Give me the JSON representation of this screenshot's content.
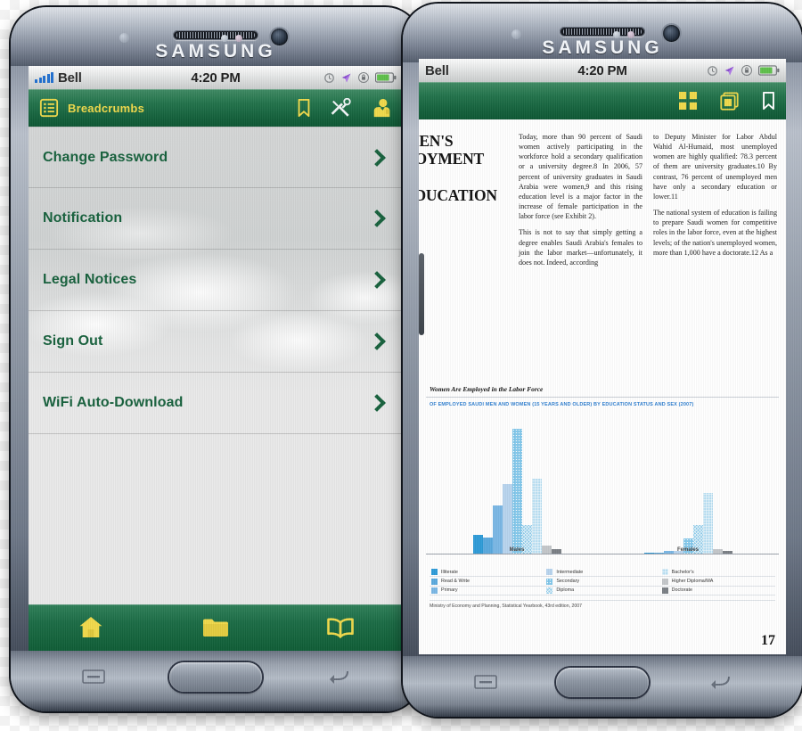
{
  "device": {
    "brand": "SAMSUNG"
  },
  "status_bar": {
    "carrier": "Bell",
    "time": "4:20 PM",
    "icons": [
      "clock-icon",
      "location-arrow-icon",
      "rotation-lock-icon",
      "battery-icon"
    ],
    "signal_bars": 5
  },
  "left_phone": {
    "nav": {
      "title": "Breadcrumbs",
      "menu_icon": "list-icon",
      "actions": [
        "bookmark-icon",
        "tools-icon",
        "contact-icon"
      ]
    },
    "menu_items": [
      {
        "label": "Change Password"
      },
      {
        "label": "Notification"
      },
      {
        "label": "Legal Notices"
      },
      {
        "label": "Sign Out"
      },
      {
        "label": "WiFi Auto-Download"
      }
    ],
    "tabbar": [
      {
        "icon": "home-icon",
        "label": "Home"
      },
      {
        "icon": "folder-icon",
        "label": "Library"
      },
      {
        "icon": "book-icon",
        "label": "Reader"
      }
    ]
  },
  "right_phone": {
    "nav": {
      "actions": [
        "grid-icon",
        "layers-icon",
        "bookmark-icon"
      ]
    },
    "document": {
      "heading": "WOMEN'S EMPLOYMENT AND EDUCATION",
      "heading_visible": [
        "MEN'S",
        "LOYMENT",
        "D EDUCATION"
      ],
      "page_number": "17",
      "column_one": [
        "Today, more than 90 percent of Saudi women actively participating in the workforce hold a secondary qualification or a university degree.8 In 2006, 57 percent of university graduates in Saudi Arabia were women,9 and this rising education level is a major factor in the increase of female participation in the labor force (see Exhibit 2).",
        "This is not to say that simply getting a degree enables Saudi Arabia's females to join the labor market—unfortunately, it does not. Indeed, according"
      ],
      "column_two": [
        "to Deputy Minister for Labor Abdul Wahid Al-Humaid, most unemployed women are highly qualified: 78.3 percent of them are university graduates.10 By contrast, 76 percent of unemployed men have only a secondary education or lower.11",
        "The national system of education is failing to prepare Saudi women for competitive roles in the labor force, even at the highest levels; of the nation's unemployed women, more than 1,000 have a doctorate.12 As a"
      ],
      "exhibit_title": "Women Are Employed in the Labor Force",
      "exhibit_subtitle": "OF EMPLOYED SAUDI MEN AND WOMEN (15 YEARS AND OLDER) BY EDUCATION STATUS AND SEX (2007)",
      "source": "Ministry of Economy and Planning, Statistical Yearbook, 43rd edition, 2007"
    }
  },
  "chart_data": {
    "type": "bar",
    "title": "Women Are Employed in the Labor Force",
    "subtitle": "OF EMPLOYED SAUDI MEN AND WOMEN (15 YEARS AND OLDER) BY EDUCATION STATUS AND SEX (2007)",
    "xlabel": "",
    "ylabel": "",
    "grid": false,
    "legend_position": "bottom",
    "categories": [
      "Males",
      "Females"
    ],
    "series": [
      {
        "name": "Illiterate",
        "color": "#2e9bd8",
        "pattern": "solid",
        "values": [
          14,
          1
        ]
      },
      {
        "name": "Read & Write",
        "color": "#5aa9de",
        "pattern": "solid",
        "values": [
          12,
          1
        ]
      },
      {
        "name": "Primary",
        "color": "#7ab7e5",
        "pattern": "solid",
        "values": [
          36,
          2
        ]
      },
      {
        "name": "Intermediate",
        "color": "#b8d4ee",
        "pattern": "solid",
        "values": [
          52,
          2
        ]
      },
      {
        "name": "Secondary",
        "color": "#7fc6ea",
        "pattern": "dotted",
        "values": [
          93,
          11
        ]
      },
      {
        "name": "Diploma",
        "color": "#8ecdec",
        "pattern": "crosshatch",
        "values": [
          21,
          21
        ]
      },
      {
        "name": "Bachelor's",
        "color": "#b9e0f4",
        "pattern": "grid",
        "values": [
          56,
          45
        ]
      },
      {
        "name": "Higher Diploma/MA",
        "color": "#c4c7ca",
        "pattern": "solid",
        "values": [
          6,
          3
        ]
      },
      {
        "name": "Doctorate",
        "color": "#7a7f85",
        "pattern": "solid",
        "values": [
          3,
          2
        ]
      }
    ],
    "source": "Ministry of Economy and Planning, Statistical Yearbook, 43rd edition, 2007"
  }
}
